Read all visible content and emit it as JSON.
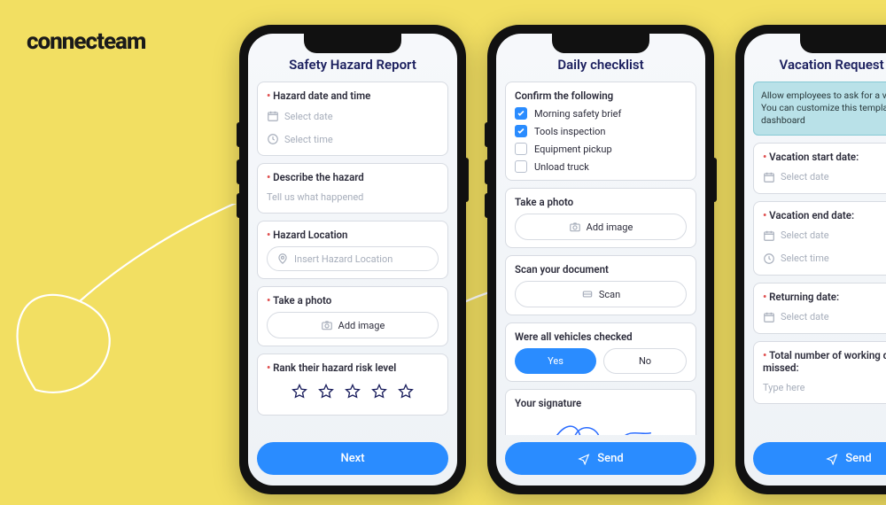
{
  "brand": "connecteam",
  "phone1": {
    "title": "Safety Hazard Report",
    "c1": {
      "label": "Hazard date and time",
      "date_ph": "Select date",
      "time_ph": "Select time"
    },
    "c2": {
      "label": "Describe the hazard",
      "ph": "Tell us what happened"
    },
    "c3": {
      "label": "Hazard Location",
      "ph": "Insert Hazard Location"
    },
    "c4": {
      "label": "Take a photo",
      "btn": "Add image"
    },
    "c5": {
      "label": "Rank their hazard risk level"
    },
    "cta": "Next"
  },
  "phone2": {
    "title": "Daily checklist",
    "confirm_label": "Confirm the following",
    "items": [
      {
        "label": "Morning safety brief",
        "checked": true
      },
      {
        "label": "Tools inspection",
        "checked": true
      },
      {
        "label": "Equipment pickup",
        "checked": false
      },
      {
        "label": "Unload truck",
        "checked": false
      }
    ],
    "photo": {
      "label": "Take a photo",
      "btn": "Add image"
    },
    "scan": {
      "label": "Scan your document",
      "btn": "Scan"
    },
    "vehicles": {
      "label": "Were all vehicles checked",
      "yes": "Yes",
      "no": "No"
    },
    "sig_label": "Your signature",
    "cta": "Send"
  },
  "phone3": {
    "title": "Vacation Request Form",
    "info": "Allow employees to ask for a vacation. You can customize this template from the dashboard",
    "c1": {
      "label": "Vacation start date:",
      "ph": "Select date"
    },
    "c2": {
      "label": "Vacation end date:",
      "date_ph": "Select date",
      "time_ph": "Select time"
    },
    "c3": {
      "label": "Returning date:",
      "ph": "Select date"
    },
    "c4": {
      "label": "Total number of working days missed:",
      "ph": "Type here"
    },
    "cta": "Send"
  }
}
